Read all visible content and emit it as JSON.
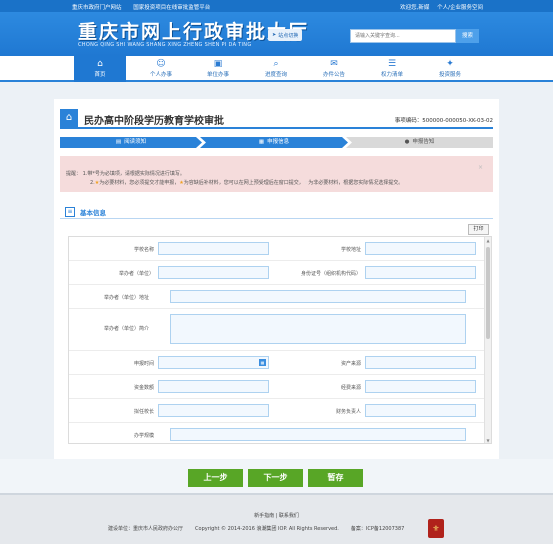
{
  "topbar": {
    "links_left": [
      "重庆市政府门户网站",
      "国家投资项目在线审批监管平台"
    ],
    "links_right": [
      "欢迎您,新媒",
      "个人/企业服务空间"
    ]
  },
  "header": {
    "logo_cn": "重庆市网上行政审批大厅",
    "logo_pinyin": "CHONG QING SHI WANG SHANG XING ZHENG SHEN PI DA TING",
    "site_switch": "站点切换",
    "search_placeholder": "请输入关键字查询...",
    "search_button": "搜索"
  },
  "nav": [
    {
      "label": "首页",
      "icon": "home-icon",
      "glyph": "⌂",
      "active": true
    },
    {
      "label": "个人办事",
      "icon": "person-icon",
      "glyph": "☺",
      "active": false
    },
    {
      "label": "单位办事",
      "icon": "briefcase-icon",
      "glyph": "▣",
      "active": false
    },
    {
      "label": "进度查询",
      "icon": "search-icon",
      "glyph": "⌕",
      "active": false
    },
    {
      "label": "办件公告",
      "icon": "announcement-icon",
      "glyph": "✉",
      "active": false
    },
    {
      "label": "权力清单",
      "icon": "list-icon",
      "glyph": "☰",
      "active": false
    },
    {
      "label": "投资服务",
      "icon": "star-icon",
      "glyph": "✦",
      "active": false
    }
  ],
  "page": {
    "title": "民办高中阶段学历教育学校审批",
    "item_code": "事项编码：500000-000050-XK-03-02"
  },
  "steps": [
    {
      "label": "阅读须知",
      "icon": "book-icon",
      "state": "done"
    },
    {
      "label": "申报信息",
      "icon": "form-icon",
      "state": "current"
    },
    {
      "label": "申报告知",
      "icon": "info-icon",
      "state": "todo"
    }
  ],
  "notice": {
    "prefix": "提醒：",
    "line1": "1.带*号为必填项，请根据实际情况进行填写。",
    "line2_a": "2.",
    "line2_b": "为必要材料，您必须提交才能申报，",
    "line2_c": "为容缺后补材料，您可以在网上预受理后在窗口提交，",
    "line2_d": "为非必要材料，根据您实际情况选择提交。",
    "close": "×"
  },
  "section": {
    "title": "基本信息",
    "print": "打印"
  },
  "form": {
    "school_name": "学校名称",
    "school_address": "学校地址",
    "sponsor": "举办者（单位）",
    "id_number": "身份证号（组织机构代码）",
    "sponsor_address": "举办者（单位）地址",
    "sponsor_intro": "举办者（单位）简介",
    "apply_time": "申报时间",
    "asset_source": "资产来源",
    "funding": "资金数额",
    "expense_source": "经费来源",
    "principal": "拟任校长",
    "finance_head": "财务负责人",
    "scale": "办学规模"
  },
  "buttons": {
    "prev": "上一步",
    "next": "下一步",
    "save": "暂存"
  },
  "footer": {
    "links": "新手指南 | 联系我们",
    "builder": "建设单位：重庆市人民政府办公厅",
    "copyright": "Copyright © 2014-2016 浪潮集团 IOP. All Rights Reserved.",
    "icp": "备案：ICP备12007387"
  },
  "colors": {
    "brand_blue": "#1f78d2",
    "button_green": "#58a626",
    "notice_bg": "#f5dcdc"
  }
}
